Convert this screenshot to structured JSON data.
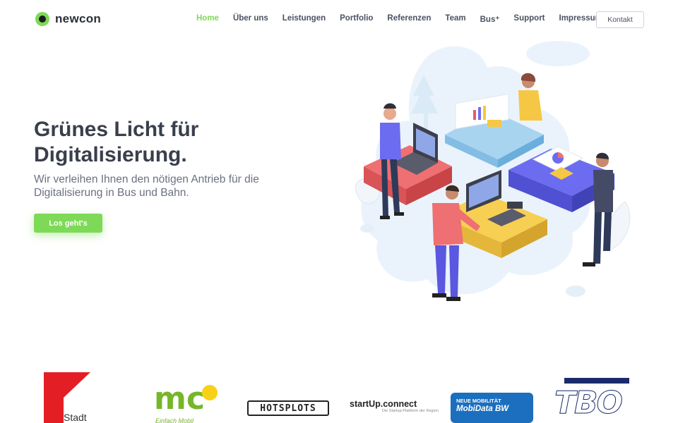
{
  "brand": {
    "name": "newcon",
    "accent": "#7ed957",
    "dark": "#3a3f4c"
  },
  "nav": {
    "items": [
      {
        "label": "Home",
        "active": true
      },
      {
        "label": "Über uns"
      },
      {
        "label": "Leistungen"
      },
      {
        "label": "Portfolio"
      },
      {
        "label": "Referenzen"
      },
      {
        "label": "Team"
      },
      {
        "label": "Bus⁺"
      },
      {
        "label": "Support"
      },
      {
        "label": "Impressum"
      }
    ],
    "contact_label": "Kontakt"
  },
  "hero": {
    "title": "Grünes Licht für Digitalisierung.",
    "subtitle": "Wir verleihen Ihnen den nötigen Antrieb für die Digitalisierung in Bus und Bahn.",
    "cta_label": "Los geht's",
    "illustration_icon": "team-puzzle-illustration-icon"
  },
  "partners": {
    "stadt": "Stadt",
    "mobil_tagline": "Einfach Mobil",
    "hotsplots": "HOTSPLOTS",
    "startup_main": "startUp.connect",
    "startup_small": "Die Startup-Plattform der Region",
    "mobidata_l1": "NEUE MOBILITÄT",
    "mobidata_l2": "MobiData BW",
    "tbo": "TBO"
  }
}
